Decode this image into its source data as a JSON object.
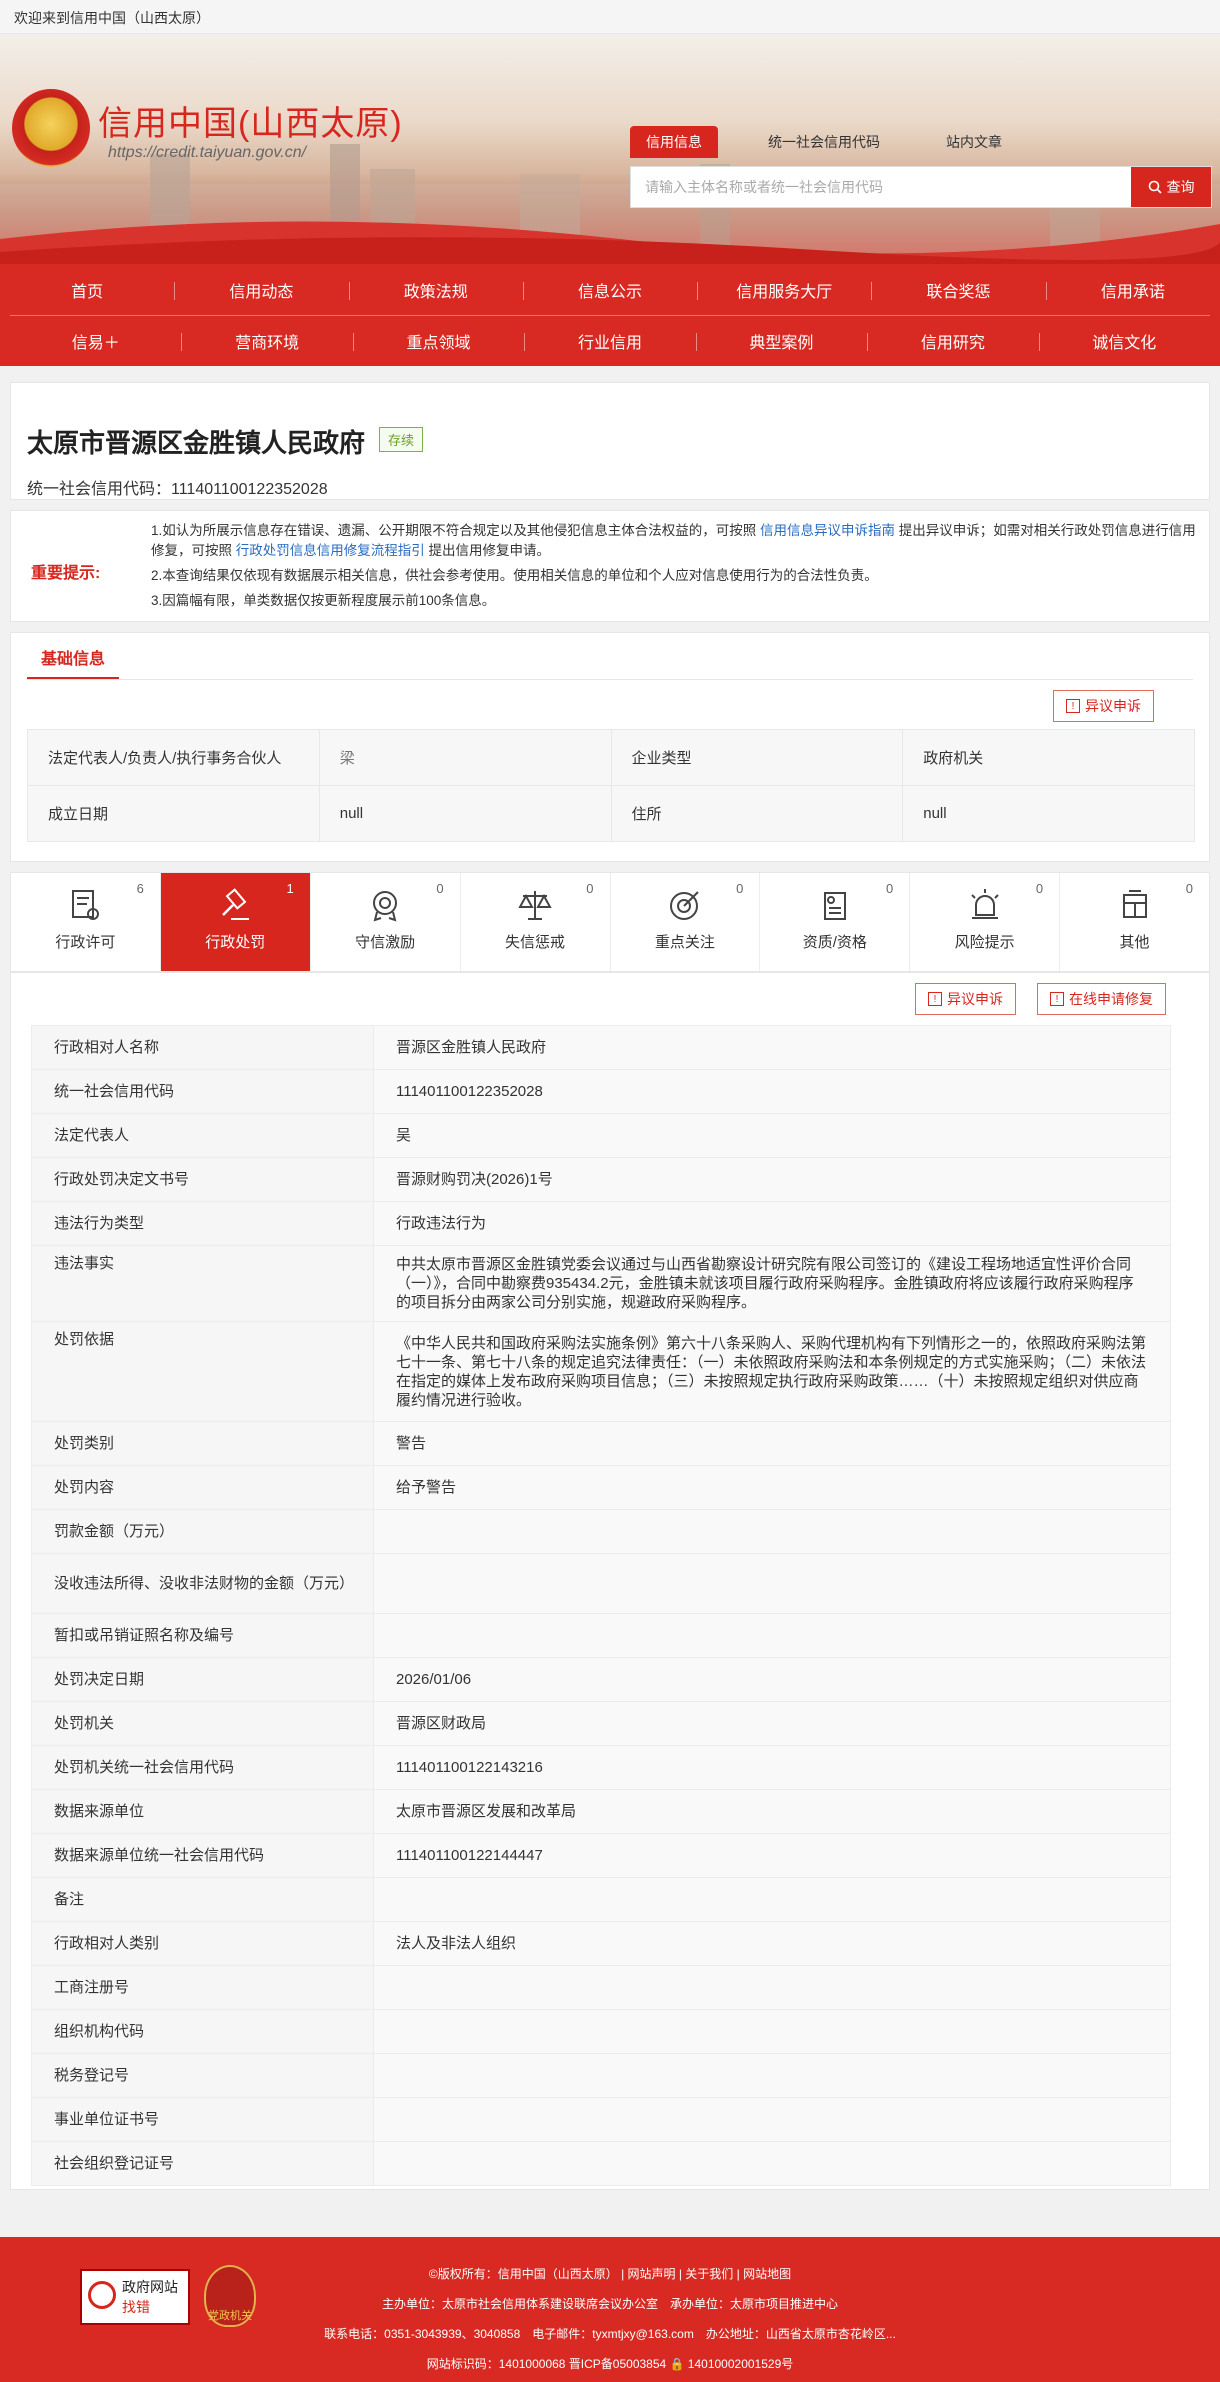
{
  "topbar": {
    "welcome": "欢迎来到信用中国（山西太原）"
  },
  "header": {
    "title": "信用中国(山西太原)",
    "url": "https://credit.taiyuan.gov.cn/",
    "search_tabs": [
      "信用信息",
      "统一社会信用代码",
      "站内文章"
    ],
    "search_placeholder": "请输入主体名称或者统一社会信用代码",
    "search_button": "查询"
  },
  "nav": {
    "row1": [
      "首页",
      "信用动态",
      "政策法规",
      "信息公示",
      "信用服务大厅",
      "联合奖惩",
      "信用承诺"
    ],
    "row2": [
      "信易＋",
      "营商环境",
      "重点领域",
      "行业信用",
      "典型案例",
      "信用研究",
      "诚信文化"
    ]
  },
  "entity": {
    "name": "太原市晋源区金胜镇人民政府",
    "status": "存续",
    "code": "统一社会信用代码：111401100122352028"
  },
  "notice": {
    "label": "重要提示:",
    "line1_a": "1.如认为所展示信息存在错误、遗漏、公开期限不符合规定以及其他侵犯信息主体合法权益的，可按照",
    "line1_link1": "信用信息异议申诉指南",
    "line1_b": "提出异议申诉；如需对相关行政处罚信息进行信用修复，可按照",
    "line1_link2": "行政处罚信息信用修复流程指引",
    "line1_c": "提出信用修复申请。",
    "line2": "2.本查询结果仅依现有数据展示相关信息，供社会参考使用。使用相关信息的单位和个人应对信息使用行为的合法性负责。",
    "line3": "3.因篇幅有限，单类数据仅按更新程度展示前100条信息。"
  },
  "basic": {
    "tab": "基础信息",
    "objection_button": "异议申诉",
    "rows": [
      [
        "法定代表人/负责人/执行事务合伙人",
        "梁",
        "企业类型",
        "政府机关"
      ],
      [
        "成立日期",
        "null",
        "住所",
        "null"
      ]
    ]
  },
  "categories": [
    {
      "label": "行政许可",
      "count": "6",
      "icon": "permit-icon"
    },
    {
      "label": "行政处罚",
      "count": "1",
      "icon": "penalty-gavel-icon"
    },
    {
      "label": "守信激励",
      "count": "0",
      "icon": "reward-medal-icon"
    },
    {
      "label": "失信惩戒",
      "count": "0",
      "icon": "scales-icon"
    },
    {
      "label": "重点关注",
      "count": "0",
      "icon": "target-icon"
    },
    {
      "label": "资质/资格",
      "count": "0",
      "icon": "certificate-icon"
    },
    {
      "label": "风险提示",
      "count": "0",
      "icon": "alarm-icon"
    },
    {
      "label": "其他",
      "count": "0",
      "icon": "other-doc-icon"
    }
  ],
  "detail": {
    "objection_button": "异议申诉",
    "repair_button": "在线申请修复",
    "rows": [
      {
        "k": "行政相对人名称",
        "v": "晋源区金胜镇人民政府"
      },
      {
        "k": "统一社会信用代码",
        "v": "111401100122352028"
      },
      {
        "k": "法定代表人",
        "v": "吴"
      },
      {
        "k": "行政处罚决定文书号",
        "v": "晋源财购罚决(2026)1号"
      },
      {
        "k": "违法行为类型",
        "v": "行政违法行为"
      },
      {
        "k": "违法事实",
        "v": "中共太原市晋源区金胜镇党委会议通过与山西省勘察设计研究院有限公司签订的《建设工程场地适宜性评价合同（一）》，合同中勘察费935434.2元，金胜镇未就该项目履行政府采购程序。金胜镇政府将应该履行政府采购程序的项目拆分由两家公司分别实施，规避政府采购程序。"
      },
      {
        "k": "处罚依据",
        "v": "《中华人民共和国政府采购法实施条例》第六十八条采购人、采购代理机构有下列情形之一的，依照政府采购法第七十一条、第七十八条的规定追究法律责任：（一）未依照政府采购法和本条例规定的方式实施采购；（二）未依法在指定的媒体上发布政府采购项目信息；（三）未按照规定执行政府采购政策……（十）未按照规定组织对供应商履约情况进行验收。"
      },
      {
        "k": "处罚类别",
        "v": "警告"
      },
      {
        "k": "处罚内容",
        "v": "给予警告"
      },
      {
        "k": "罚款金额（万元）",
        "v": ""
      },
      {
        "k": "没收违法所得、没收非法财物的金额（万元）",
        "v": ""
      },
      {
        "k": "暂扣或吊销证照名称及编号",
        "v": ""
      },
      {
        "k": "处罚决定日期",
        "v": "2026/01/06"
      },
      {
        "k": "处罚机关",
        "v": "晋源区财政局"
      },
      {
        "k": "处罚机关统一社会信用代码",
        "v": "111401100122143216"
      },
      {
        "k": "数据来源单位",
        "v": "太原市晋源区发展和改革局"
      },
      {
        "k": "数据来源单位统一社会信用代码",
        "v": "111401100122144447"
      },
      {
        "k": "备注",
        "v": ""
      },
      {
        "k": "行政相对人类别",
        "v": "法人及非法人组织"
      },
      {
        "k": "工商注册号",
        "v": ""
      },
      {
        "k": "组织机构代码",
        "v": ""
      },
      {
        "k": "税务登记号",
        "v": ""
      },
      {
        "k": "事业单位证书号",
        "v": ""
      },
      {
        "k": "社会组织登记证号",
        "v": ""
      }
    ]
  },
  "footer": {
    "badge1_line1": "政府网站",
    "badge1_line2": "找错",
    "badge2": "党政机关",
    "line1": "©版权所有：信用中国（山西太原） | 网站声明 | 关于我们 | 网站地图",
    "line2": "主办单位：太原市社会信用体系建设联席会议办公室　承办单位：太原市项目推进中心",
    "line3": "联系电话：0351-3043939、3040858　电子邮件：tyxmtjxy@163.com　办公地址：山西省太原市杏花岭区...",
    "line4": "网站标识码：1401000068 晋ICP备05003854 🔒 14010002001529号"
  },
  "colors": {
    "brand_red": "#d7261e",
    "status_green": "#6a9e2b",
    "link_blue": "#2a6cc0"
  }
}
